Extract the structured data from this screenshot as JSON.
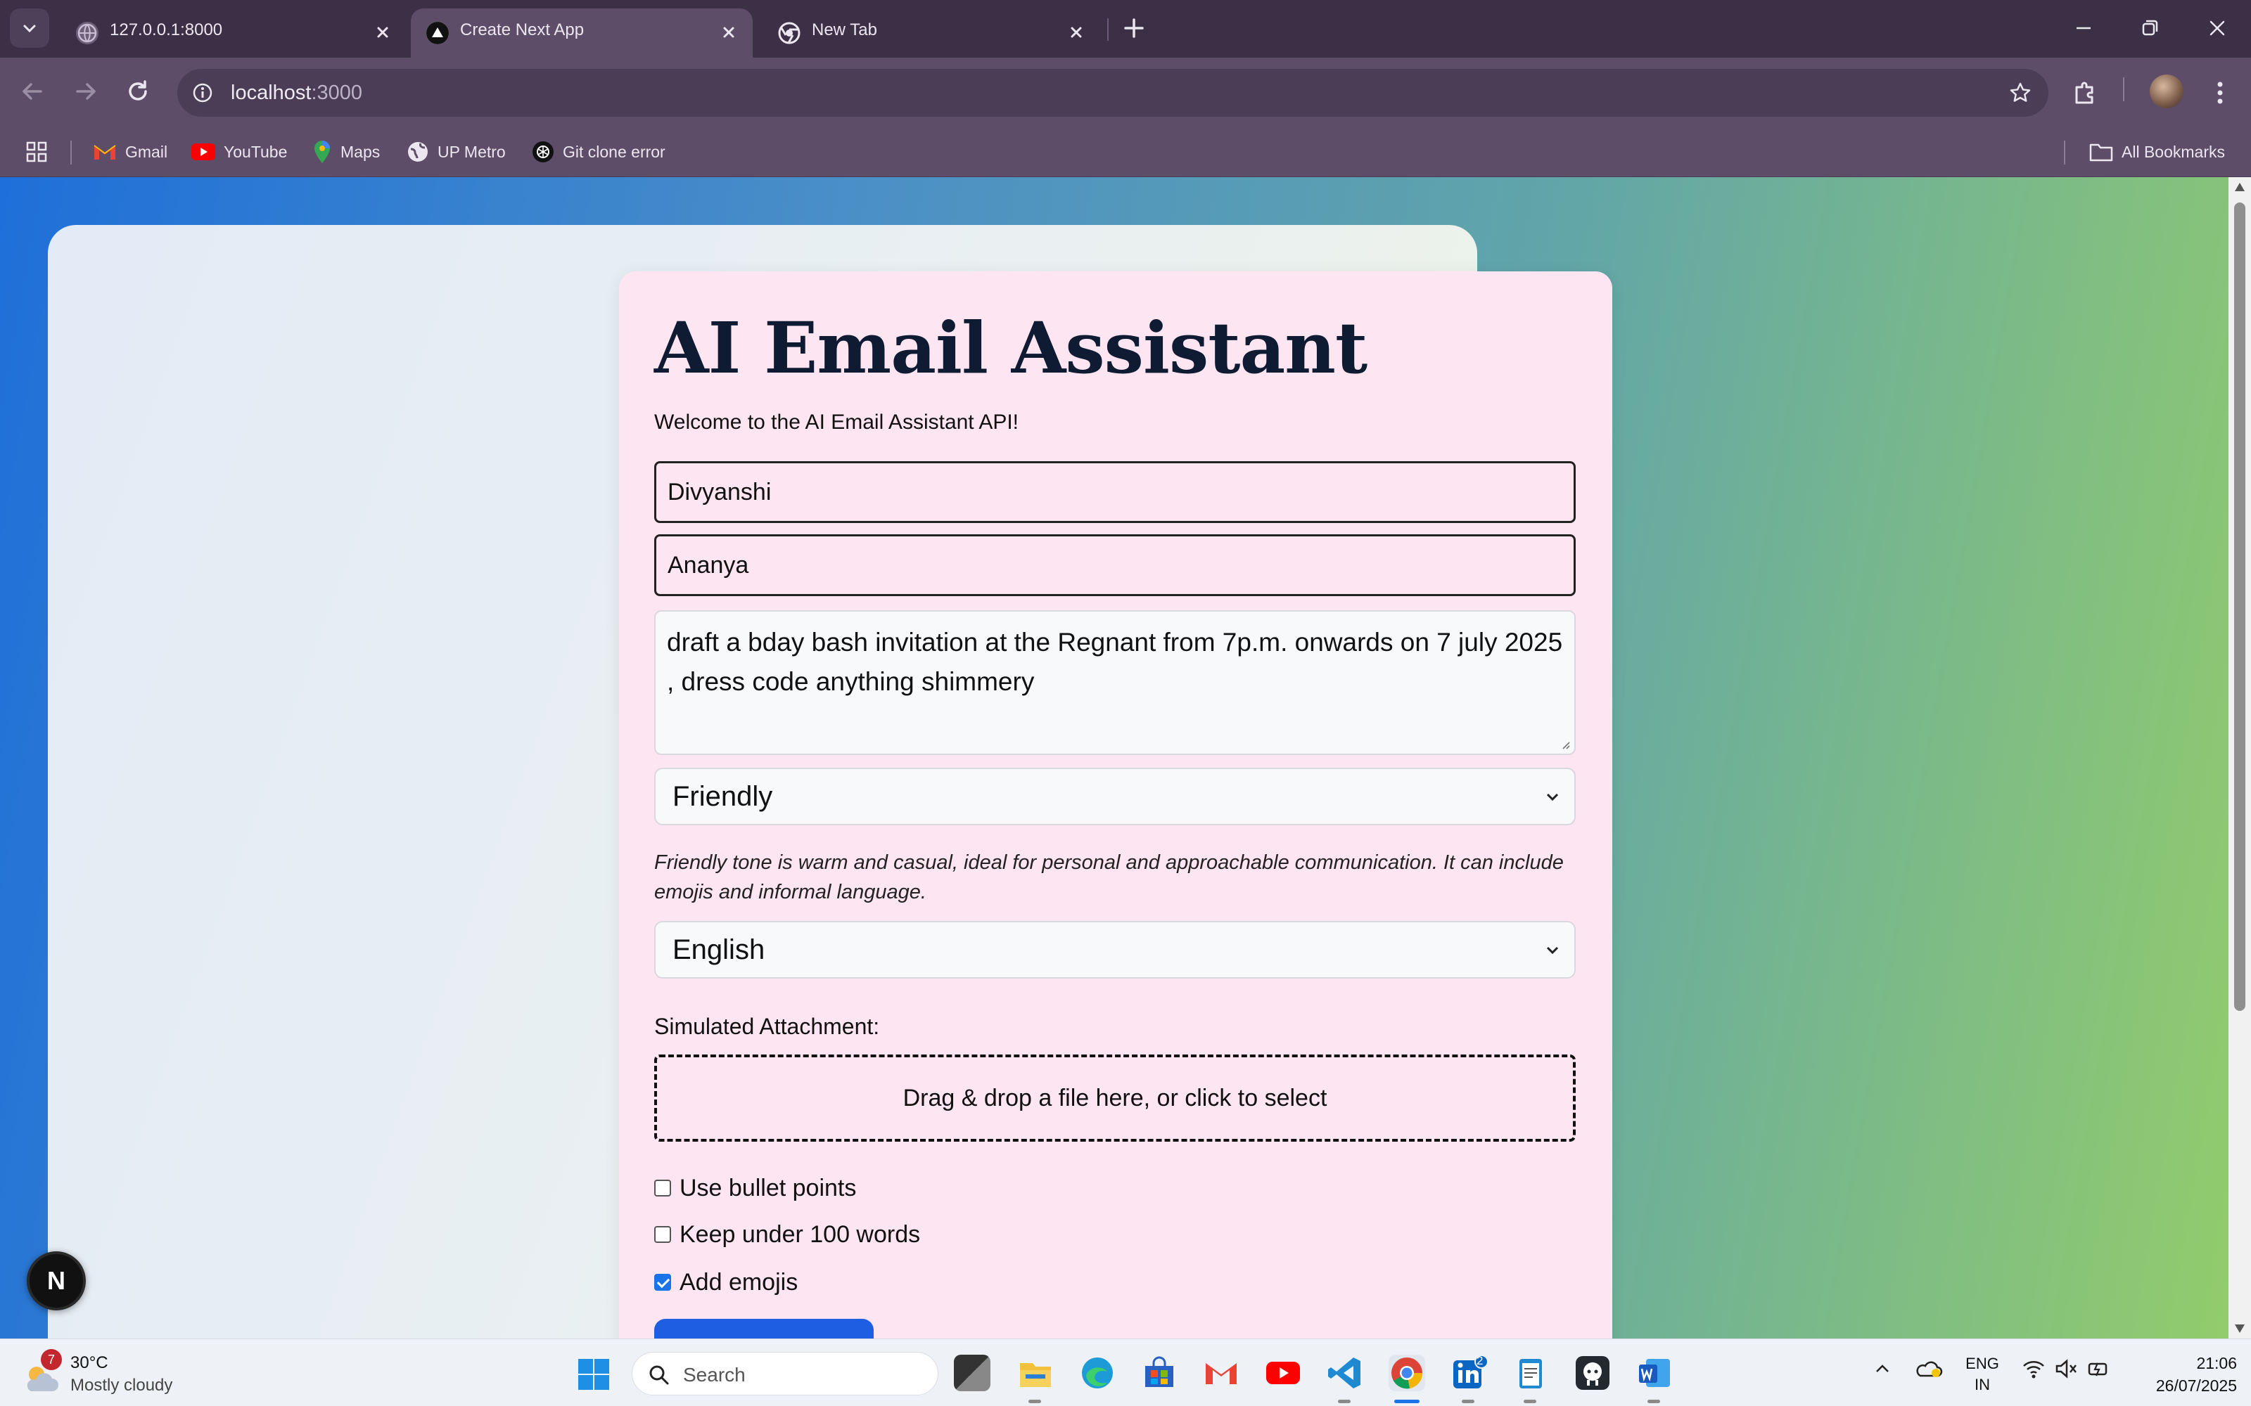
{
  "browser": {
    "tabs": [
      {
        "title": "127.0.0.1:8000",
        "active": false
      },
      {
        "title": "Create Next App",
        "active": true
      },
      {
        "title": "New Tab",
        "active": false
      }
    ],
    "url_host": "localhost",
    "url_port": ":3000",
    "bookmarks": [
      "Gmail",
      "YouTube",
      "Maps",
      "UP Metro",
      "Git clone error"
    ],
    "all_bookmarks": "All Bookmarks"
  },
  "page": {
    "title": "AI Email Assistant",
    "subtitle": "Welcome to the AI Email Assistant API!",
    "sender_value": "Divyanshi",
    "recipient_value": "Ananya",
    "prompt_value": "draft a bday bash invitation at the Regnant from 7p.m. onwards on 7 july 2025 , dress code anything shimmery",
    "tone_selected": "Friendly",
    "tone_description": "Friendly tone is warm and casual, ideal for personal and approachable communication. It can include emojis and informal language.",
    "language_selected": "English",
    "attachment_label": "Simulated Attachment:",
    "dropzone_text": "Drag & drop a file here, or click to select",
    "options": [
      {
        "label": "Use bullet points",
        "checked": false
      },
      {
        "label": "Keep under 100 words",
        "checked": false
      },
      {
        "label": "Add emojis",
        "checked": true
      }
    ],
    "dev_badge": "N"
  },
  "taskbar": {
    "weather_badge": "7",
    "temperature": "30°C",
    "condition": "Mostly cloudy",
    "search_label": "Search",
    "linkedin_badge": "2",
    "lang_top": "ENG",
    "lang_bottom": "IN",
    "time": "21:06",
    "date": "26/07/2025"
  },
  "colors": {
    "card_bg": "#fde5f1",
    "accent_blue": "#1d5fe0",
    "title_color": "#0f1a33"
  }
}
